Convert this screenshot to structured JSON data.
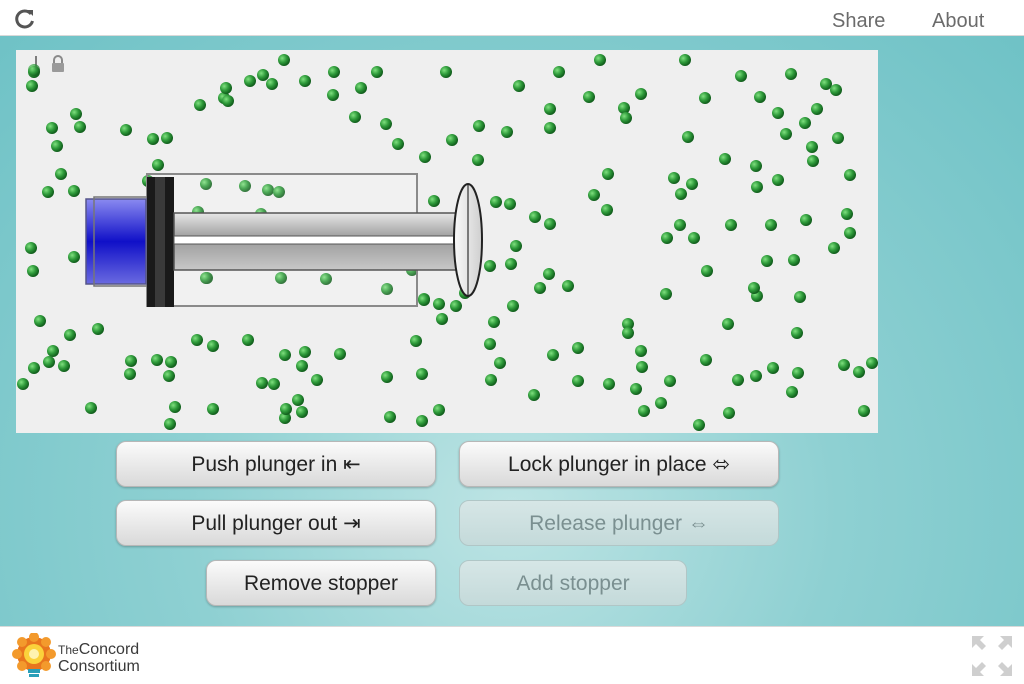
{
  "header": {
    "reload_icon": "reload-icon",
    "share_label": "Share",
    "about_label": "About"
  },
  "simulation": {
    "molecule_color": "#2e9a3a",
    "plunger_color": "#2222cc",
    "stopper_removed": true,
    "lock_icon": "lock-icon",
    "thermometer_icon": "thermometer-icon"
  },
  "controls": {
    "push_label": "Push plunger in ⇤",
    "lock_label": "Lock plunger in place ⬄",
    "pull_label": "Pull plunger out ⇥",
    "release_label": "Release plunger ⇔",
    "remove_stopper_label": "Remove stopper",
    "add_stopper_label": "Add stopper"
  },
  "footer": {
    "logo_line1_small": "The",
    "logo_line1": "Concord",
    "logo_line2": "Consortium",
    "fullscreen_icon": "fullscreen-icon"
  }
}
